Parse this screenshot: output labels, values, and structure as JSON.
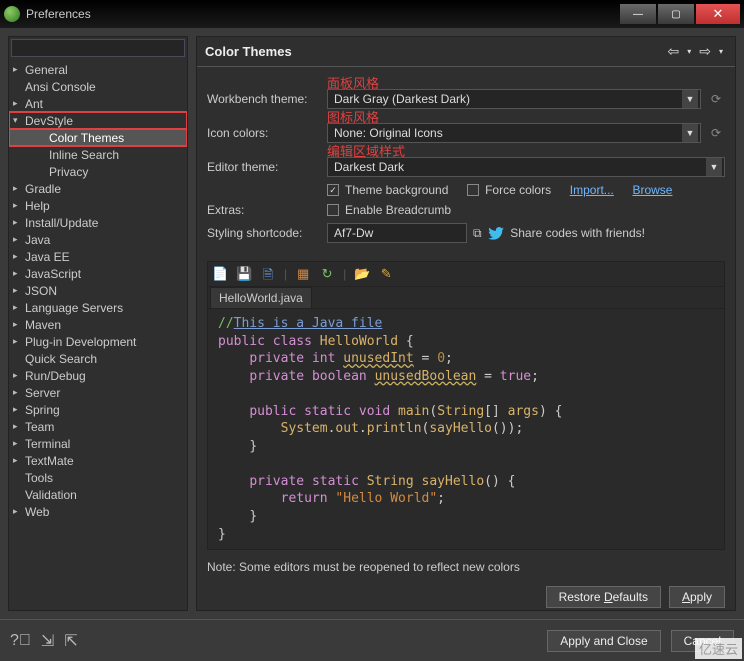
{
  "window_title": "Preferences",
  "sidebar": {
    "items": [
      {
        "label": "General",
        "expandable": true
      },
      {
        "label": "Ansi Console"
      },
      {
        "label": "Ant",
        "expandable": true
      },
      {
        "label": "DevStyle",
        "expandable": true,
        "expanded": true,
        "highlight": true,
        "children": [
          {
            "label": "Color Themes",
            "selected": true,
            "highlight": true
          },
          {
            "label": "Inline Search"
          },
          {
            "label": "Privacy"
          }
        ]
      },
      {
        "label": "Gradle",
        "expandable": true
      },
      {
        "label": "Help",
        "expandable": true
      },
      {
        "label": "Install/Update",
        "expandable": true
      },
      {
        "label": "Java",
        "expandable": true
      },
      {
        "label": "Java EE",
        "expandable": true
      },
      {
        "label": "JavaScript",
        "expandable": true
      },
      {
        "label": "JSON",
        "expandable": true
      },
      {
        "label": "Language Servers",
        "expandable": true
      },
      {
        "label": "Maven",
        "expandable": true
      },
      {
        "label": "Plug-in Development",
        "expandable": true
      },
      {
        "label": "Quick Search"
      },
      {
        "label": "Run/Debug",
        "expandable": true
      },
      {
        "label": "Server",
        "expandable": true
      },
      {
        "label": "Spring",
        "expandable": true
      },
      {
        "label": "Team",
        "expandable": true
      },
      {
        "label": "Terminal",
        "expandable": true
      },
      {
        "label": "TextMate",
        "expandable": true
      },
      {
        "label": "Tools"
      },
      {
        "label": "Validation"
      },
      {
        "label": "Web",
        "expandable": true
      }
    ]
  },
  "main": {
    "title": "Color Themes",
    "annotations": {
      "workbench": "面板风格",
      "icons": "图标风格",
      "editor": "编辑区域样式"
    },
    "labels": {
      "workbench": "Workbench theme:",
      "icons": "Icon colors:",
      "editor": "Editor theme:",
      "extras": "Extras:",
      "shortcode": "Styling shortcode:"
    },
    "values": {
      "workbench": "Dark Gray (Darkest Dark)",
      "icons": "None: Original Icons",
      "editor": "Darkest Dark",
      "shortcode": "Af7-Dw"
    },
    "checks": {
      "theme_bg": {
        "label": "Theme background",
        "checked": true
      },
      "force_colors": {
        "label": "Force colors",
        "checked": false
      },
      "breadcrumb": {
        "label": "Enable Breadcrumb",
        "checked": false
      }
    },
    "links": {
      "import": "Import...",
      "browse": "Browse"
    },
    "share_text": "Share codes with friends!",
    "editor_tab": "HelloWorld.java",
    "code": {
      "l1a": "//",
      "l1b": "This is a Java file",
      "l2": "public",
      "l2b": "class",
      "l2c": "HelloWorld",
      "l3": "private",
      "l3b": "int",
      "l3c": "unusedInt",
      "l3d": "0",
      "l4": "private",
      "l4b": "boolean",
      "l4c": "unusedBoolean",
      "l4d": "true",
      "l5": "public",
      "l5b": "static",
      "l5c": "void",
      "l5d": "main",
      "l5e": "String",
      "l5f": "args",
      "l6a": "System",
      "l6b": "out",
      "l6c": "println",
      "l6d": "sayHello",
      "l7": "private",
      "l7b": "static",
      "l7c": "String",
      "l7d": "sayHello",
      "l8": "return",
      "l8b": "\"Hello World\""
    },
    "note": "Note: Some editors must be reopened to reflect new colors",
    "buttons": {
      "restore": "Restore Defaults",
      "apply": "Apply",
      "apply_close": "Apply and Close",
      "cancel": "Cancel"
    }
  },
  "watermark": "亿速云"
}
